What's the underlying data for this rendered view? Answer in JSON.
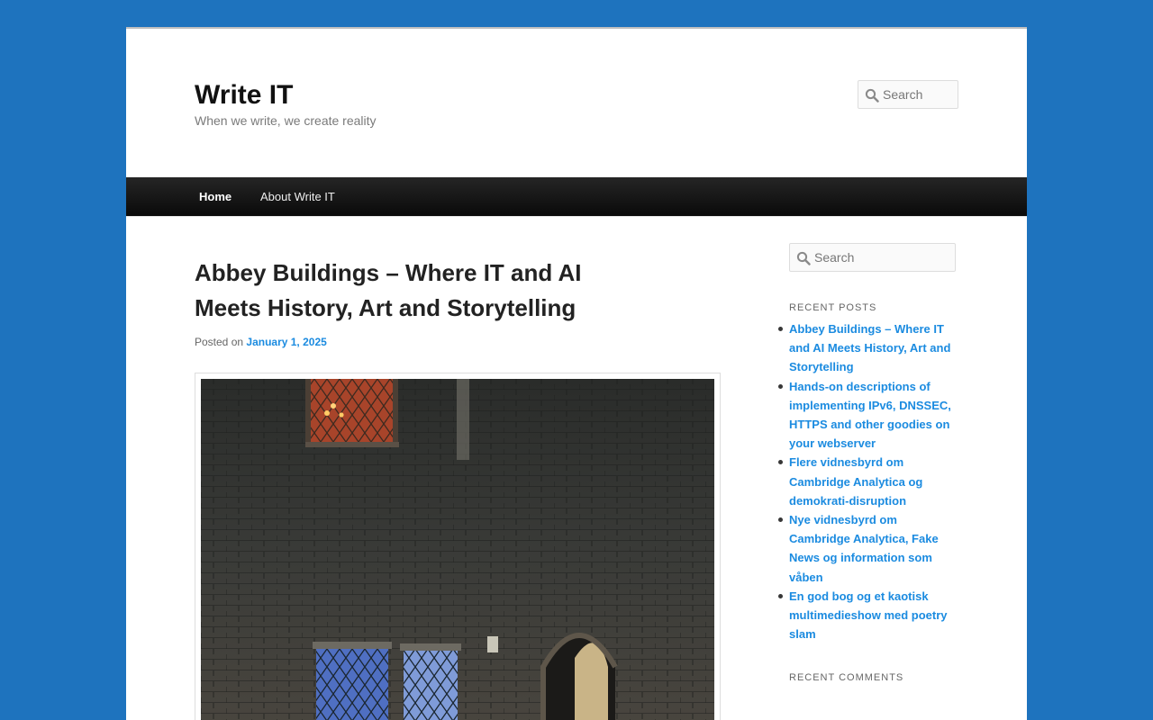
{
  "site": {
    "title": "Write IT",
    "tagline": "When we write, we create reality"
  },
  "header_search": {
    "placeholder": "Search"
  },
  "nav": {
    "items": [
      {
        "label": "Home"
      },
      {
        "label": "About Write IT"
      }
    ]
  },
  "post": {
    "title": "Abbey Buildings – Where IT and AI Meets History, Art and Storytelling",
    "posted_on_label": "Posted on",
    "date": "January 1, 2025"
  },
  "sidebar": {
    "search_placeholder": "Search",
    "recent_posts_title": "Recent Posts",
    "recent_posts": [
      "Abbey Buildings – Where IT and AI Meets History, Art and Storytelling",
      "Hands-on descriptions of implementing IPv6, DNSSEC, HTTPS and other goodies on your webserver",
      "Flere vidnesbyrd om Cambridge Analytica og demokrati-disruption",
      "Nye vidnesbyrd om Cambridge Analytica, Fake News og information som våben",
      "En god bog og et kaotisk multimedieshow med poetry slam"
    ],
    "recent_comments_title": "Recent Comments"
  },
  "colors": {
    "background": "#1e73be",
    "link": "#1b8be0",
    "nav_bar": "#111111"
  },
  "icons": {
    "search": "magnifier-icon"
  }
}
